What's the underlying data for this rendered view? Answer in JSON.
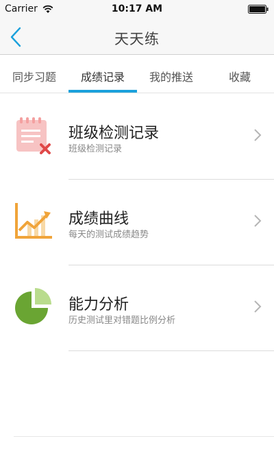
{
  "status_bar": {
    "carrier": "Carrier",
    "time": "10:17 AM"
  },
  "nav": {
    "title": "天天练",
    "back_icon": "chevron-left-icon",
    "accent": "#1ba1dc"
  },
  "tabs": [
    {
      "label": "同步习题",
      "active": false
    },
    {
      "label": "成绩记录",
      "active": true
    },
    {
      "label": "我的推送",
      "active": false
    },
    {
      "label": "收藏",
      "active": false
    }
  ],
  "list": [
    {
      "title": "班级检测记录",
      "subtitle": "班级检测记录",
      "icon": "class-test-record-icon"
    },
    {
      "title": "成绩曲线",
      "subtitle": "每天的测试成绩趋势",
      "icon": "score-curve-chart-icon"
    },
    {
      "title": "能力分析",
      "subtitle": "历史测试里对错题比例分析",
      "icon": "ability-pie-chart-icon"
    }
  ]
}
